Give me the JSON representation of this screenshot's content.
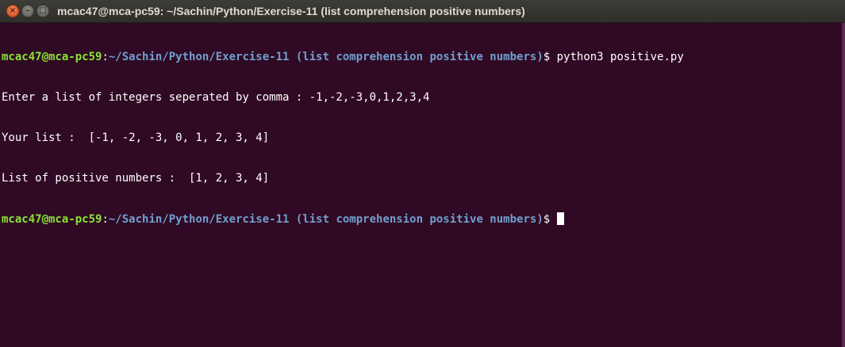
{
  "window": {
    "title": "mcac47@mca-pc59: ~/Sachin/Python/Exercise-11 (list comprehension positive numbers)",
    "close_glyph": "×",
    "minimize_glyph": "–",
    "maximize_glyph": "□"
  },
  "terminal": {
    "prompt_user_host": "mcac47@mca-pc59",
    "prompt_colon": ":",
    "prompt_path": "~/Sachin/Python/Exercise-11 (list comprehension positive numbers)",
    "prompt_dollar": "$ ",
    "command": "python3 positive.py",
    "output": [
      "Enter a list of integers seperated by comma : -1,-2,-3,0,1,2,3,4",
      "Your list :  [-1, -2, -3, 0, 1, 2, 3, 4]",
      "List of positive numbers :  [1, 2, 3, 4]"
    ]
  },
  "colors": {
    "background": "#300a24",
    "prompt_user": "#8ae234",
    "prompt_path": "#729fcf",
    "text": "#ffffff"
  },
  "icons": {
    "close": "close-icon",
    "minimize": "minimize-icon",
    "maximize": "maximize-icon"
  }
}
